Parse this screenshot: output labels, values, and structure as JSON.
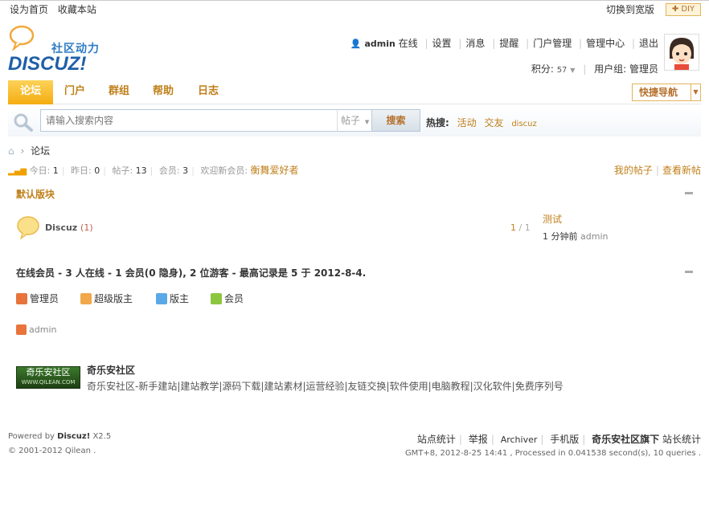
{
  "topbar": {
    "set_home": "设为首页",
    "bookmark": "收藏本站",
    "switch_wide": "切换到宽版",
    "diy": "DIY"
  },
  "logo": {
    "slogan": "社区动力",
    "brand": "DISCUZ!"
  },
  "user": {
    "name": "admin",
    "status": "在线",
    "links": [
      "设置",
      "消息",
      "提醒",
      "门户管理",
      "管理中心",
      "退出"
    ],
    "points_label": "积分:",
    "points": "57",
    "group_label": "用户组:",
    "group": "管理员"
  },
  "nav": {
    "tabs": [
      "论坛",
      "门户",
      "群组",
      "帮助",
      "日志"
    ],
    "quick_nav": "快捷导航"
  },
  "search": {
    "placeholder": "请输入搜索内容",
    "type": "帖子",
    "button": "搜索",
    "hot_label": "热搜:",
    "hot_keywords": [
      "活动",
      "交友",
      "discuz"
    ]
  },
  "breadcrumb": {
    "current": "论坛"
  },
  "stats": {
    "today_label": "今日:",
    "today": "1",
    "yesterday_label": "昨日:",
    "yesterday": "0",
    "posts_label": "帖子:",
    "posts": "13",
    "members_label": "会员:",
    "members": "3",
    "welcome_label": "欢迎新会员:",
    "new_member": "衡舞爱好者",
    "my_posts": "我的帖子",
    "new_posts": "查看新帖"
  },
  "section": {
    "title": "默认版块"
  },
  "forum": {
    "name": "Discuz",
    "count": "(1)",
    "ratio_a": "1",
    "ratio_b": "1",
    "last_title": "测试",
    "last_time": "1 分钟前",
    "last_user": "admin"
  },
  "online": {
    "title": "在线会员 - 3 人在线 - 1 会员(0 隐身), 2 位游客 - 最高记录是 5 于 2012-8-4.",
    "legend": [
      "管理员",
      "超级版主",
      "版主",
      "会员"
    ],
    "user": "admin"
  },
  "linkbox": {
    "logo_text": "奇乐安社区",
    "logo_url": "WWW.QILEAN.COM",
    "title": "奇乐安社区",
    "desc": "奇乐安社区-新手建站|建站教学|源码下载|建站素材|运营经验|友链交换|软件使用|电脑教程|汉化软件|免费序列号"
  },
  "footer": {
    "powered_prefix": "Powered by",
    "product": "Discuz!",
    "version": "X2.5",
    "copyright": "© 2001-2012 Qilean .",
    "links": [
      "站点统计",
      "举报",
      "Archiver",
      "手机版"
    ],
    "owner": "奇乐安社区旗下",
    "owner_link": "站长统计",
    "time_info": "GMT+8, 2012-8-25 14:41 , Processed in 0.041538 second(s), 10 queries ."
  },
  "colors": {
    "accent": "#c07f19",
    "nav_active": "#f5ac10",
    "admin_icon": "#e8743b",
    "supermod_icon": "#f0a84a",
    "mod_icon": "#5aa9e6",
    "member_icon": "#8cc63f"
  }
}
